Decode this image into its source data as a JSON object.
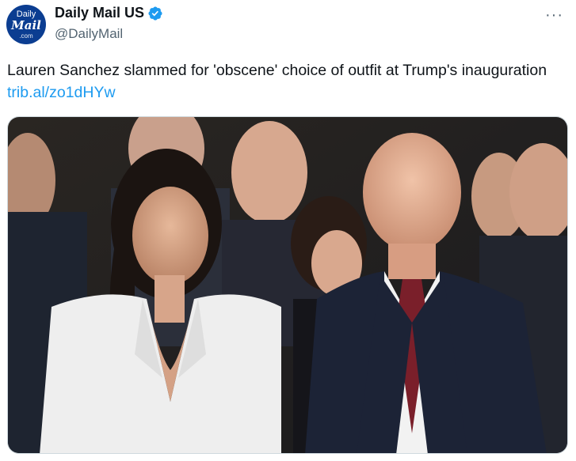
{
  "account": {
    "name": "Daily Mail US",
    "handle": "@DailyMail",
    "avatar_lines": [
      "Daily",
      "Mail",
      ".com"
    ],
    "verified": true,
    "verified_color": "#1d9bf0"
  },
  "more_label": "···",
  "tweet": {
    "text": "Lauren Sanchez slammed for 'obscene' choice of outfit at Trump's inauguration ",
    "link": "trib.al/zo1dHYw"
  },
  "colors": {
    "link": "#1d9bf0",
    "handle": "#536471",
    "avatar_bg": "#0b3d91"
  },
  "media": {
    "type": "photo"
  }
}
